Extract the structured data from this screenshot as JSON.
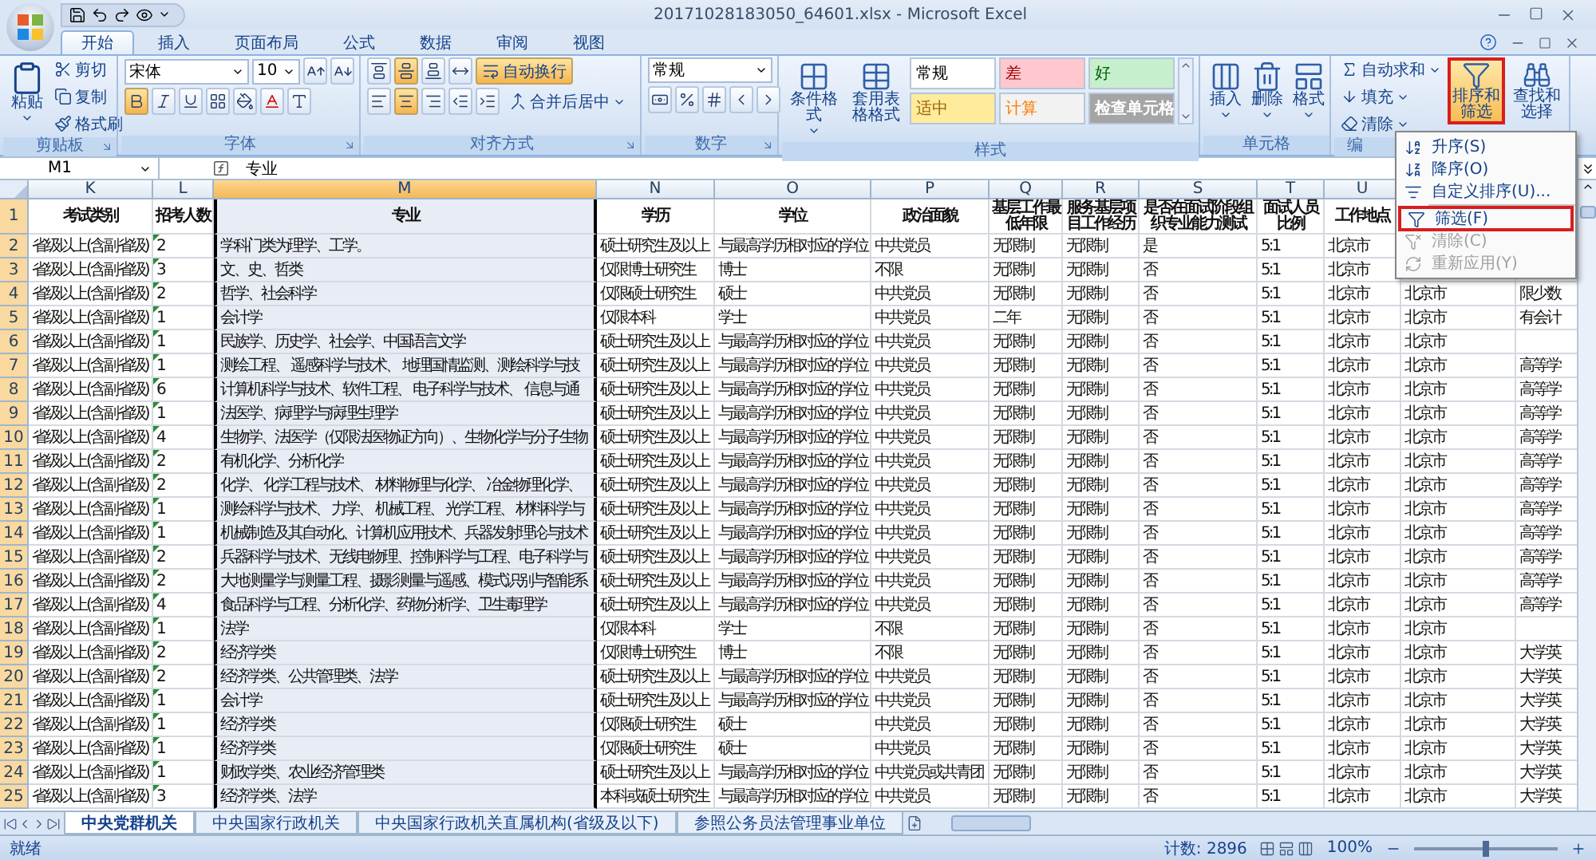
{
  "window": {
    "title": "20171028183050_64601.xlsx - Microsoft Excel"
  },
  "ribbon_tabs": [
    {
      "label": "开始",
      "selected": true
    },
    {
      "label": "插入",
      "selected": false
    },
    {
      "label": "页面布局",
      "selected": false
    },
    {
      "label": "公式",
      "selected": false
    },
    {
      "label": "数据",
      "selected": false
    },
    {
      "label": "审阅",
      "selected": false
    },
    {
      "label": "视图",
      "selected": false
    }
  ],
  "ribbon_groups": [
    {
      "kind": "clipboard",
      "label": "剪贴板",
      "big_button": "粘贴",
      "buttons": [
        "剪切",
        "复制",
        "格式刷"
      ]
    },
    {
      "kind": "font",
      "label": "字体",
      "font_name": "宋体",
      "font_size": "10",
      "style_buttons": [
        {
          "kind": "bold",
          "on": true
        },
        {
          "kind": "italic",
          "on": false
        },
        {
          "kind": "underline",
          "on": false
        }
      ]
    },
    {
      "kind": "alignment",
      "label": "对齐方式",
      "v_align": [
        {
          "kind": "top",
          "on": false
        },
        {
          "kind": "middle",
          "on": true
        },
        {
          "kind": "bottom",
          "on": false
        }
      ],
      "h_align": [
        {
          "kind": "left",
          "on": false
        },
        {
          "kind": "center",
          "on": true
        },
        {
          "kind": "right",
          "on": false
        }
      ],
      "wrap": {
        "label": "自动换行",
        "on": true
      },
      "merge": {
        "label": "合并后居中"
      }
    },
    {
      "kind": "number",
      "label": "数字",
      "format": "常规"
    },
    {
      "kind": "styles",
      "label": "样式",
      "big_buttons": [
        "条件格式",
        "套用表格格式"
      ],
      "cell_styles": [
        {
          "kind": "normal",
          "label": "常规",
          "color": "#ffffff"
        },
        {
          "kind": "bad",
          "label": "差",
          "color": "#ffc7ce"
        },
        {
          "kind": "good",
          "label": "好",
          "color": "#c6efce"
        },
        {
          "kind": "neutral",
          "label": "适中",
          "color": "#ffeb9c"
        },
        {
          "kind": "calculation",
          "label": "计算",
          "color": "#f2f2f2"
        },
        {
          "kind": "check",
          "label": "检查单元格",
          "color": "#a5a5a5"
        }
      ]
    },
    {
      "kind": "cells",
      "label": "单元格",
      "big_buttons": [
        "插入",
        "删除",
        "格式"
      ]
    },
    {
      "kind": "editing",
      "label": "编",
      "buttons": [
        "自动求和",
        "填充",
        "清除"
      ],
      "big_buttons": [
        {
          "label": "排序和筛选",
          "highlighted": true
        },
        {
          "label": "查找和选择",
          "highlighted": false
        }
      ]
    }
  ],
  "formula_bar": {
    "name_box": "M1",
    "formula": "专业"
  },
  "columns": [
    {
      "letter": "K",
      "selected": false
    },
    {
      "letter": "L",
      "selected": false
    },
    {
      "letter": "M",
      "selected": true
    },
    {
      "letter": "N",
      "selected": false
    },
    {
      "letter": "O",
      "selected": false
    },
    {
      "letter": "P",
      "selected": false
    },
    {
      "letter": "Q",
      "selected": false
    },
    {
      "letter": "R",
      "selected": false
    },
    {
      "letter": "S",
      "selected": false
    },
    {
      "letter": "T",
      "selected": false
    },
    {
      "letter": "U",
      "selected": false
    }
  ],
  "header_row": {
    "number": "1",
    "cells": [
      "考试类别",
      "招考人数",
      "专业",
      "学历",
      "学位",
      "政治面貌",
      "基层工作最低年限",
      "服务基层项目工作经历",
      "是否在面试阶段组织专业能力测试",
      "面试人员比例",
      "工作地点",
      null,
      null
    ]
  },
  "rows": [
    {
      "number": "2",
      "error_mark": true,
      "cells": [
        "省级以上(含副省级)",
        "2",
        "学科门类为理学、工学。",
        "硕士研究生及以上",
        "与最高学历相对应的学位",
        "中共党员",
        "无限制",
        "无限制",
        "是",
        "5:1",
        "北京市",
        null,
        null
      ]
    },
    {
      "number": "3",
      "error_mark": true,
      "cells": [
        "省级以上(含副省级)",
        "3",
        "文、史、哲类",
        "仅限博士研究生",
        "博士",
        "不限",
        "无限制",
        "无限制",
        "否",
        "5:1",
        "北京市",
        null,
        null
      ]
    },
    {
      "number": "4",
      "error_mark": true,
      "cells": [
        "省级以上(含副省级)",
        "2",
        "哲学、社会科学",
        "仅限硕士研究生",
        "硕士",
        "中共党员",
        "无限制",
        "无限制",
        "否",
        "5:1",
        "北京市",
        "北京市",
        "限少数"
      ]
    },
    {
      "number": "5",
      "error_mark": true,
      "cells": [
        "省级以上(含副省级)",
        "1",
        "会计学",
        "仅限本科",
        "学士",
        "中共党员",
        "二年",
        "无限制",
        "否",
        "5:1",
        "北京市",
        "北京市",
        "有会计"
      ]
    },
    {
      "number": "6",
      "error_mark": true,
      "cells": [
        "省级以上(含副省级)",
        "1",
        "民族学、历史学、社会学、中国语言文学",
        "硕士研究生及以上",
        "与最高学历相对应的学位",
        "中共党员",
        "无限制",
        "无限制",
        "否",
        "5:1",
        "北京市",
        "北京市",
        null
      ]
    },
    {
      "number": "7",
      "error_mark": true,
      "cells": [
        "省级以上(含副省级)",
        "1",
        "测绘工程、 遥感科学与技术、 地理国情监测、测绘科学与技",
        "硕士研究生及以上",
        "与最高学历相对应的学位",
        "中共党员",
        "无限制",
        "无限制",
        "否",
        "5:1",
        "北京市",
        "北京市",
        "高等学"
      ]
    },
    {
      "number": "8",
      "error_mark": true,
      "cells": [
        "省级以上(含副省级)",
        "6",
        "计算机科学与技术、软件工程、 电子科学与技术、 信息与通",
        "硕士研究生及以上",
        "与最高学历相对应的学位",
        "中共党员",
        "无限制",
        "无限制",
        "否",
        "5:1",
        "北京市",
        "北京市",
        "高等学"
      ]
    },
    {
      "number": "9",
      "error_mark": true,
      "cells": [
        "省级以上(含副省级)",
        "1",
        "法医学、病理学与病理生理学",
        "硕士研究生及以上",
        "与最高学历相对应的学位",
        "中共党员",
        "无限制",
        "无限制",
        "否",
        "5:1",
        "北京市",
        "北京市",
        "高等学"
      ]
    },
    {
      "number": "10",
      "error_mark": true,
      "cells": [
        "省级以上(含副省级)",
        "4",
        "生物学、法医学（仅限法医物证方向）、生物化学与分子生物",
        "硕士研究生及以上",
        "与最高学历相对应的学位",
        "中共党员",
        "无限制",
        "无限制",
        "否",
        "5:1",
        "北京市",
        "北京市",
        "高等学"
      ]
    },
    {
      "number": "11",
      "error_mark": true,
      "cells": [
        "省级以上(含副省级)",
        "2",
        "有机化学、分析化学",
        "硕士研究生及以上",
        "与最高学历相对应的学位",
        "中共党员",
        "无限制",
        "无限制",
        "否",
        "5:1",
        "北京市",
        "北京市",
        "高等学"
      ]
    },
    {
      "number": "12",
      "error_mark": true,
      "cells": [
        "省级以上(含副省级)",
        "2",
        "化学、 化学工程与技术、 材料物理与化学、 冶金物理化学、",
        "硕士研究生及以上",
        "与最高学历相对应的学位",
        "中共党员",
        "无限制",
        "无限制",
        "否",
        "5:1",
        "北京市",
        "北京市",
        "高等学"
      ]
    },
    {
      "number": "13",
      "error_mark": true,
      "cells": [
        "省级以上(含副省级)",
        "1",
        "测绘科学与技术、 力学、 机械工程、 光学工程、 材料科学与",
        "硕士研究生及以上",
        "与最高学历相对应的学位",
        "中共党员",
        "无限制",
        "无限制",
        "否",
        "5:1",
        "北京市",
        "北京市",
        "高等学"
      ]
    },
    {
      "number": "14",
      "error_mark": true,
      "cells": [
        "省级以上(含副省级)",
        "1",
        "机械制造及其自动化、计算机应用技术、兵器发射理论与技术",
        "硕士研究生及以上",
        "与最高学历相对应的学位",
        "中共党员",
        "无限制",
        "无限制",
        "否",
        "5:1",
        "北京市",
        "北京市",
        "高等学"
      ]
    },
    {
      "number": "15",
      "error_mark": true,
      "cells": [
        "省级以上(含副省级)",
        "2",
        "兵器科学与技术、无线电物理、控制科学与工程、电子科学与",
        "硕士研究生及以上",
        "与最高学历相对应的学位",
        "中共党员",
        "无限制",
        "无限制",
        "否",
        "5:1",
        "北京市",
        "北京市",
        "高等学"
      ]
    },
    {
      "number": "16",
      "error_mark": true,
      "cells": [
        "省级以上(含副省级)",
        "2",
        "大地测量学与测量工程、摄影测量与遥感、模式识别与智能系",
        "硕士研究生及以上",
        "与最高学历相对应的学位",
        "中共党员",
        "无限制",
        "无限制",
        "否",
        "5:1",
        "北京市",
        "北京市",
        "高等学"
      ]
    },
    {
      "number": "17",
      "error_mark": true,
      "cells": [
        "省级以上(含副省级)",
        "4",
        "食品科学与工程、分析化学、药物分析学、卫生毒理学",
        "硕士研究生及以上",
        "与最高学历相对应的学位",
        "中共党员",
        "无限制",
        "无限制",
        "否",
        "5:1",
        "北京市",
        "北京市",
        "高等学"
      ]
    },
    {
      "number": "18",
      "error_mark": true,
      "cells": [
        "省级以上(含副省级)",
        "1",
        "法学",
        "仅限本科",
        "学士",
        "不限",
        "无限制",
        "无限制",
        "否",
        "5:1",
        "北京市",
        "北京市",
        null
      ]
    },
    {
      "number": "19",
      "error_mark": true,
      "cells": [
        "省级以上(含副省级)",
        "2",
        "经济学类",
        "仅限博士研究生",
        "博士",
        "不限",
        "无限制",
        "无限制",
        "否",
        "5:1",
        "北京市",
        "北京市",
        "大学英"
      ]
    },
    {
      "number": "20",
      "error_mark": true,
      "cells": [
        "省级以上(含副省级)",
        "2",
        "经济学类、公共管理类、法学",
        "硕士研究生及以上",
        "与最高学历相对应的学位",
        "中共党员",
        "无限制",
        "无限制",
        "否",
        "5:1",
        "北京市",
        "北京市",
        "大学英"
      ]
    },
    {
      "number": "21",
      "error_mark": true,
      "cells": [
        "省级以上(含副省级)",
        "1",
        "会计学",
        "硕士研究生及以上",
        "与最高学历相对应的学位",
        "中共党员",
        "无限制",
        "无限制",
        "否",
        "5:1",
        "北京市",
        "北京市",
        "大学英"
      ]
    },
    {
      "number": "22",
      "error_mark": true,
      "cells": [
        "省级以上(含副省级)",
        "1",
        "经济学类",
        "仅限硕士研究生",
        "硕士",
        "中共党员",
        "无限制",
        "无限制",
        "否",
        "5:1",
        "北京市",
        "北京市",
        "大学英"
      ]
    },
    {
      "number": "23",
      "error_mark": true,
      "cells": [
        "省级以上(含副省级)",
        "1",
        "经济学类",
        "仅限硕士研究生",
        "硕士",
        "中共党员",
        "无限制",
        "无限制",
        "否",
        "5:1",
        "北京市",
        "北京市",
        "大学英"
      ]
    },
    {
      "number": "24",
      "error_mark": true,
      "cells": [
        "省级以上(含副省级)",
        "1",
        "财政学类、农业经济管理类",
        "硕士研究生及以上",
        "与最高学历相对应的学位",
        "中共党员或共青团",
        "无限制",
        "无限制",
        "否",
        "5:1",
        "北京市",
        "北京市",
        "大学英"
      ]
    },
    {
      "number": "25",
      "error_mark": true,
      "cells": [
        "省级以上(含副省级)",
        "3",
        "经济学类、法学",
        "本科或硕士研究生",
        "与最高学历相对应的学位",
        "中共党员",
        "无限制",
        "无限制",
        "否",
        "5:1",
        "北京市",
        "北京市",
        "大学英"
      ]
    }
  ],
  "sort_menu": {
    "items": [
      {
        "kind": "asc",
        "label": "升序(S)",
        "disabled": false,
        "highlighted": false
      },
      {
        "kind": "desc",
        "label": "降序(O)",
        "disabled": false,
        "highlighted": false
      },
      {
        "kind": "custom",
        "label": "自定义排序(U)...",
        "disabled": false,
        "highlighted": false
      },
      {
        "kind": "filter",
        "label": "筛选(F)",
        "disabled": false,
        "highlighted": true
      },
      {
        "kind": "clear",
        "label": "清除(C)",
        "disabled": true,
        "highlighted": false
      },
      {
        "kind": "reapply",
        "label": "重新应用(Y)",
        "disabled": true,
        "highlighted": false
      }
    ]
  },
  "sheet_tabs": [
    {
      "label": "中央党群机关",
      "selected": true
    },
    {
      "label": "中央国家行政机关",
      "selected": false
    },
    {
      "label": "中央国家行政机关直属机构(省级及以下)",
      "selected": false
    },
    {
      "label": "参照公务员法管理事业单位",
      "selected": false
    }
  ],
  "status_bar": {
    "status": "就绪",
    "count": "计数: 2896",
    "zoom": "100%",
    "level": 0.5
  }
}
